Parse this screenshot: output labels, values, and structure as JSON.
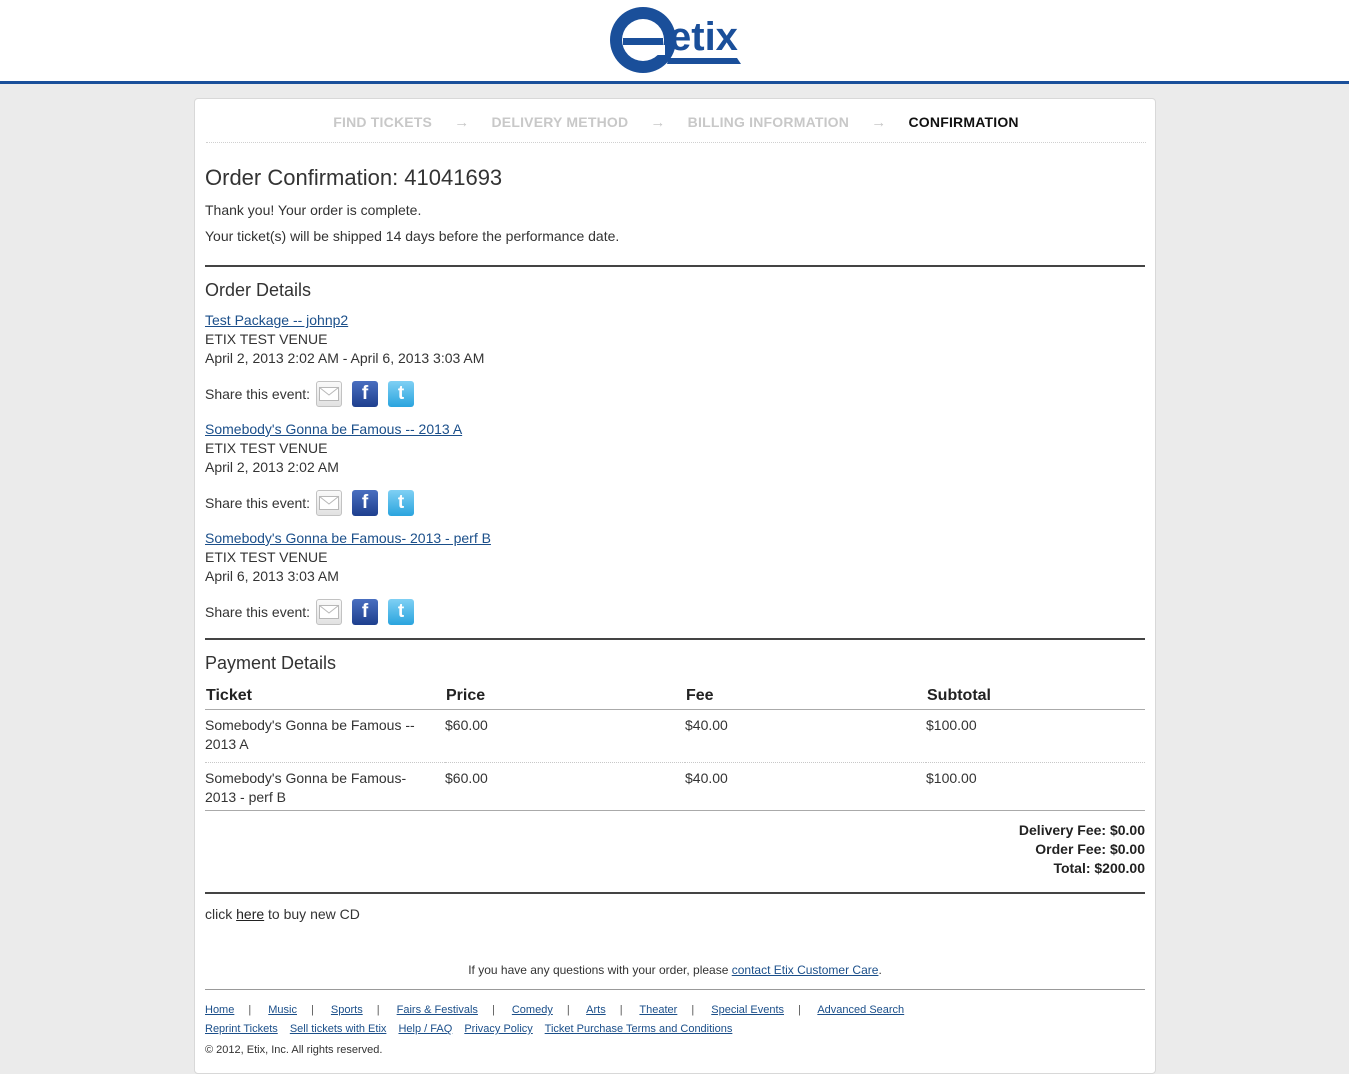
{
  "brand": {
    "logo_text": "etix"
  },
  "steps": [
    "FIND TICKETS",
    "DELIVERY METHOD",
    "BILLING INFORMATION",
    "CONFIRMATION"
  ],
  "arrow": "→",
  "confirmation": {
    "title": "Order Confirmation: 41041693",
    "thanks": "Thank you! Your order is complete.",
    "shipping": "Your ticket(s) will be shipped 14 days before the performance date."
  },
  "order_details": {
    "heading": "Order Details",
    "share_label": "Share this event:",
    "events": [
      {
        "name": "Test Package -- johnp2 ",
        "venue": "ETIX TEST VENUE",
        "date": "April 2, 2013 2:02 AM - April 6, 2013 3:03 AM"
      },
      {
        "name": "Somebody's Gonna be Famous -- 2013 A",
        "venue": "ETIX TEST VENUE",
        "date": "April 2, 2013 2:02 AM"
      },
      {
        "name": "Somebody's Gonna be Famous- 2013 - perf B",
        "venue": "ETIX TEST VENUE",
        "date": "April 6, 2013 3:03 AM"
      }
    ]
  },
  "payment": {
    "heading": "Payment Details",
    "columns": [
      "Ticket",
      "Price",
      "Fee",
      "Subtotal"
    ],
    "rows": [
      {
        "ticket": "Somebody's Gonna be Famous -- 2013 A",
        "price": "$60.00",
        "fee": "$40.00",
        "subtotal": "$100.00"
      },
      {
        "ticket": "Somebody's Gonna be Famous- 2013 - perf B",
        "price": "$60.00",
        "fee": "$40.00",
        "subtotal": "$100.00"
      }
    ],
    "delivery_fee": "Delivery Fee: $0.00",
    "order_fee": "Order Fee: $0.00",
    "total": "Total: $200.00"
  },
  "cd": {
    "before": "click ",
    "link": "here",
    "after": " to buy new CD"
  },
  "help": {
    "before": "If you have any questions with your order, please ",
    "link": "contact Etix Customer Care",
    "after": "."
  },
  "footer": {
    "row1": [
      "Home",
      "Music",
      "Sports",
      "Fairs & Festivals",
      "Comedy",
      "Arts",
      "Theater",
      "Special Events",
      "Advanced Search"
    ],
    "row2": [
      "Reprint Tickets",
      "Sell tickets with Etix",
      "Help / FAQ",
      "Privacy Policy",
      "Ticket Purchase Terms and Conditions"
    ],
    "copyright": "© 2012, Etix, Inc. All rights reserved."
  },
  "colors": {
    "brand_blue": "#1a4f9a",
    "link": "#1b4f8a"
  }
}
